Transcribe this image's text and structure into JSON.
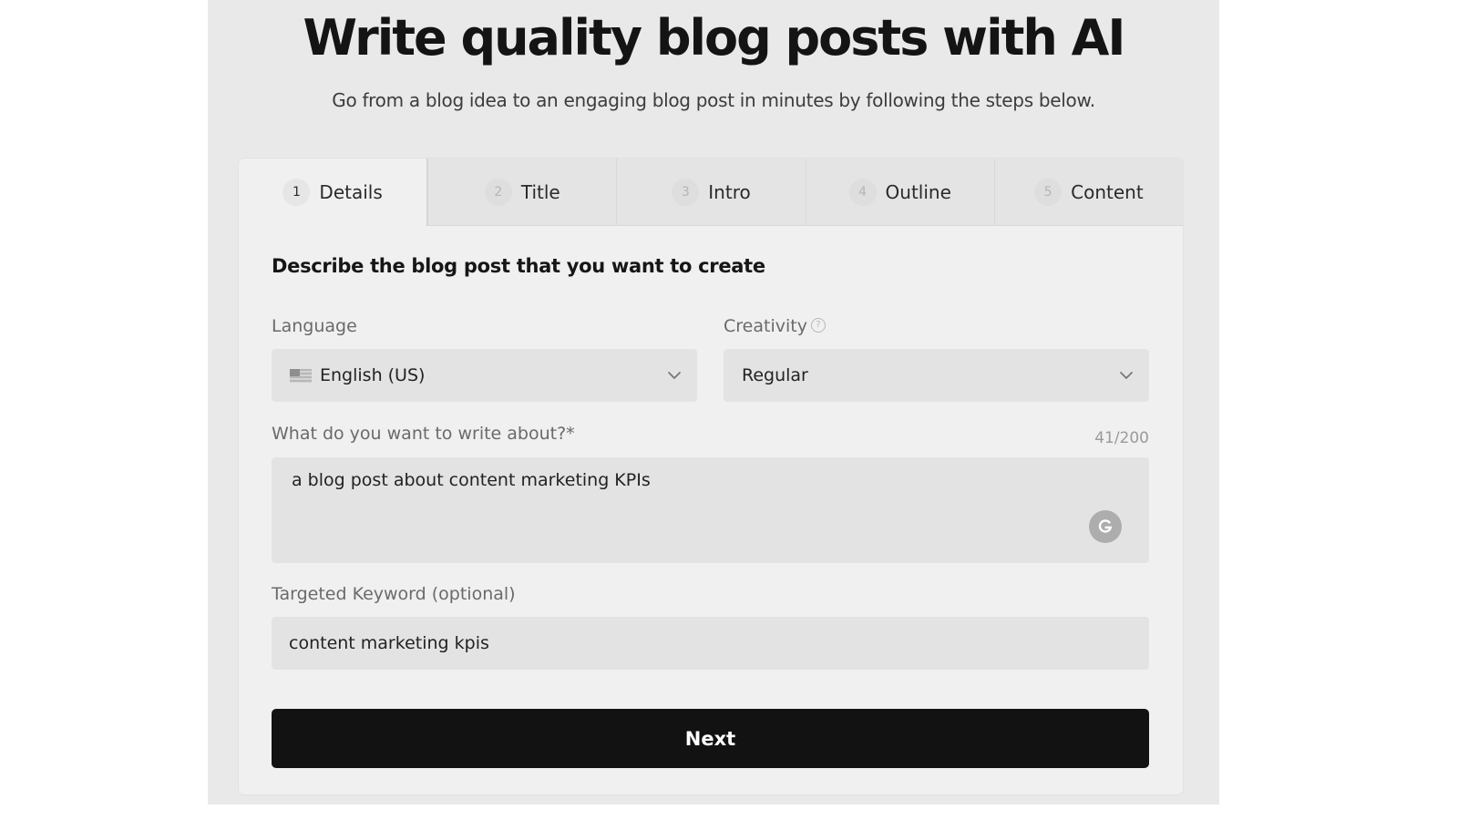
{
  "hero": {
    "title": "Write quality blog posts with AI",
    "subtitle": "Go from a blog idea to an engaging blog post in minutes by following the steps below."
  },
  "tabs": [
    {
      "number": "1",
      "label": "Details",
      "active": true
    },
    {
      "number": "2",
      "label": "Title",
      "active": false
    },
    {
      "number": "3",
      "label": "Intro",
      "active": false
    },
    {
      "number": "4",
      "label": "Outline",
      "active": false
    },
    {
      "number": "5",
      "label": "Content",
      "active": false
    }
  ],
  "form": {
    "heading": "Describe the blog post that you want to create",
    "language": {
      "label": "Language",
      "value": "English (US)",
      "flag_icon": "us-flag-icon"
    },
    "creativity": {
      "label": "Creativity",
      "help_glyph": "?",
      "value": "Regular"
    },
    "topic": {
      "label": "What do you want to write about?*",
      "counter": "41/200",
      "value": "a blog post about content marketing KPIs"
    },
    "keyword": {
      "label": "Targeted Keyword (optional)",
      "value": "content marketing kpis"
    },
    "next_label": "Next"
  },
  "colors": {
    "panel_bg": "#e9e9e9",
    "card_bg": "#f0f0f0",
    "field_bg": "#e3e3e3",
    "button_bg": "#121212",
    "button_text": "#ffffff"
  }
}
